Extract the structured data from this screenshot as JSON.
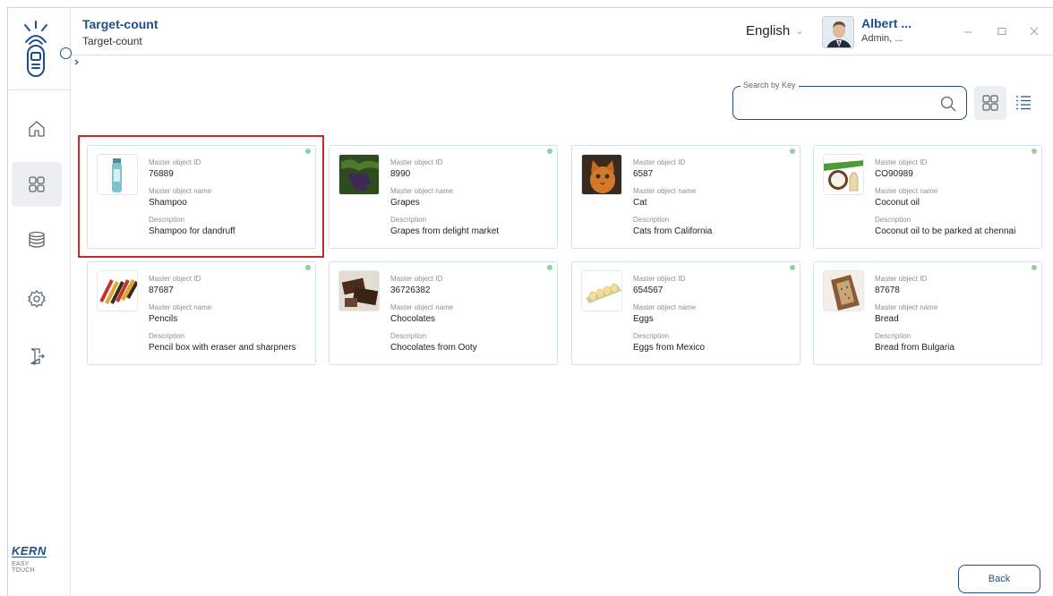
{
  "header": {
    "title": "Target-count",
    "subtitle": "Target-count",
    "language": "English",
    "user_name": "Albert ...",
    "user_role": "Admin, ..."
  },
  "brand": {
    "name": "KERN",
    "tagline": "EASY TOUCH"
  },
  "sidebar": {
    "items": [
      {
        "icon": "home-icon"
      },
      {
        "icon": "grid-icon",
        "active": true
      },
      {
        "icon": "database-icon"
      },
      {
        "icon": "settings-icon"
      },
      {
        "icon": "logout-icon"
      }
    ]
  },
  "search": {
    "legend": "Search by Key",
    "value": "",
    "placeholder": ""
  },
  "view_mode": "grid",
  "labels": {
    "id": "Master object ID",
    "name": "Master object name",
    "description": "Description"
  },
  "cards": [
    {
      "id": "76889",
      "name": "Shampoo",
      "description": "Shampoo for dandruff",
      "image": "shampoo",
      "selected": true
    },
    {
      "id": "8990",
      "name": "Grapes",
      "description": "Grapes from delight market",
      "image": "grapes"
    },
    {
      "id": "6587",
      "name": "Cat",
      "description": "Cats from California",
      "image": "cat"
    },
    {
      "id": "CO90989",
      "name": "Coconut oil",
      "description": "Coconut oil to be parked at chennai",
      "image": "coconut"
    },
    {
      "id": "87687",
      "name": "Pencils",
      "description": "Pencil box with eraser and sharpners",
      "image": "pencils"
    },
    {
      "id": "36726382",
      "name": "Chocolates",
      "description": "Chocolates from Ooty",
      "image": "chocolates"
    },
    {
      "id": "654567",
      "name": "Eggs",
      "description": "Eggs from Mexico",
      "image": "eggs"
    },
    {
      "id": "87678",
      "name": "Bread",
      "description": "Bread from Bulgaria",
      "image": "bread"
    }
  ],
  "footer": {
    "back_label": "Back"
  },
  "colors": {
    "accent": "#1d4f8c",
    "status_dot": "#8fd19e",
    "selection": "#c62828"
  }
}
